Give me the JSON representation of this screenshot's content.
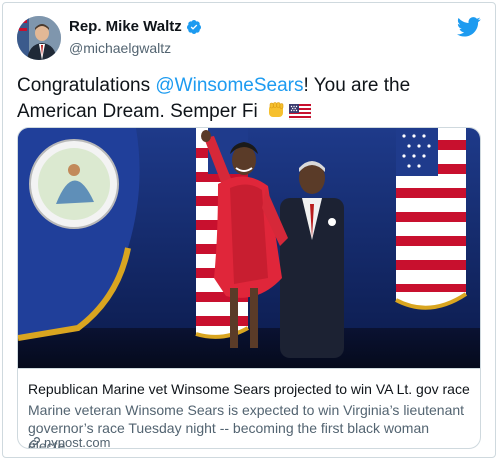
{
  "author": {
    "display_name": "Rep. Mike Waltz",
    "handle": "@michaelgwaltz",
    "verified": true
  },
  "tweet": {
    "text_before": "Congratulations ",
    "mention": "@WinsomeSears",
    "text_after": "! You are the American Dream. Semper Fi",
    "emojis": [
      "fist-emoji",
      "us-flag-emoji"
    ]
  },
  "link_card": {
    "title": "Republican Marine vet Winsome Sears projected to win VA Lt. gov race",
    "description": "Marine veteran Winsome Sears is expected to win Virginia’s lieutenant governor’s race Tuesday night -- becoming the first black woman electe...",
    "domain": "nypost.com"
  },
  "colors": {
    "accent": "#1d9bf0",
    "text": "#0f1419",
    "secondary_text": "#536471",
    "border": "#cfd9de"
  },
  "icons": [
    "verified-badge-icon",
    "twitter-bird-icon",
    "link-icon"
  ]
}
